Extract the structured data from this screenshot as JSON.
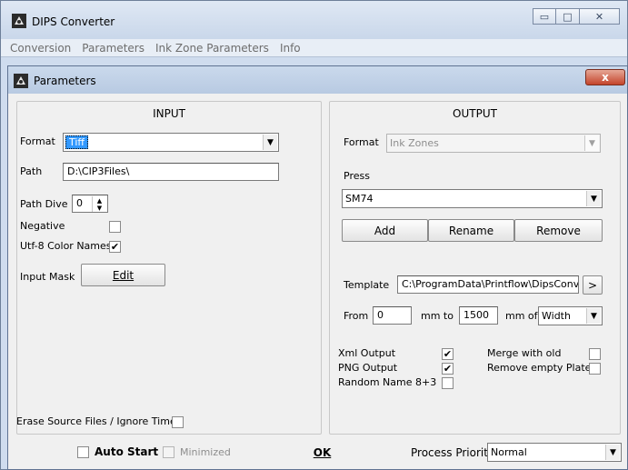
{
  "app": {
    "title": "DIPS Converter",
    "window_buttons": {
      "minimize": "▭",
      "maximize": "□",
      "close": "✕"
    },
    "menu": [
      "Conversion",
      "Parameters",
      "Ink Zone Parameters",
      "Info"
    ]
  },
  "dialog": {
    "title": "Parameters",
    "close_label": "x"
  },
  "input": {
    "title": "INPUT",
    "format_label": "Format",
    "format_value": "Tiff",
    "path_label": "Path",
    "path_value": "D:\\CIP3Files\\",
    "path_dive_label": "Path Dive",
    "path_dive_value": "0",
    "negative_label": "Negative",
    "negative_checked": false,
    "utf8_label": "Utf-8 Color Names",
    "utf8_checked": true,
    "input_mask_label": "Input Mask",
    "edit_button": "Edit"
  },
  "output": {
    "title": "OUTPUT",
    "format_label": "Format",
    "format_value": "Ink Zones",
    "press_label": "Press",
    "press_value": "SM74",
    "add_button": "Add",
    "rename_button": "Rename",
    "remove_button": "Remove",
    "template_label": "Template",
    "template_value": "C:\\ProgramData\\Printflow\\DipsConve",
    "template_browse": ">",
    "from_label": "From",
    "from_value": "0",
    "mm_to_label": "mm  to",
    "to_value": "1500",
    "mm_of_label": "mm of",
    "of_value": "Width",
    "xml_output_label": "Xml Output",
    "xml_output_checked": true,
    "png_output_label": "PNG Output",
    "png_output_checked": true,
    "random_name_label": "Random Name 8+3",
    "random_name_checked": false,
    "merge_label": "Merge with old",
    "merge_checked": false,
    "remove_empty_label": "Remove empty Plates",
    "remove_empty_checked": false
  },
  "erase_label": "Erase Source Files / Ignore Time",
  "erase_checked": false,
  "bottom": {
    "auto_start_label": "Auto Start",
    "auto_start_checked": false,
    "minimized_label": "Minimized",
    "minimized_checked": false,
    "ok_button": "OK",
    "priority_label": "Process Priority",
    "priority_value": "Normal"
  },
  "colors": {
    "selection": "#3399ff",
    "dialog_close": "#c4442b"
  }
}
